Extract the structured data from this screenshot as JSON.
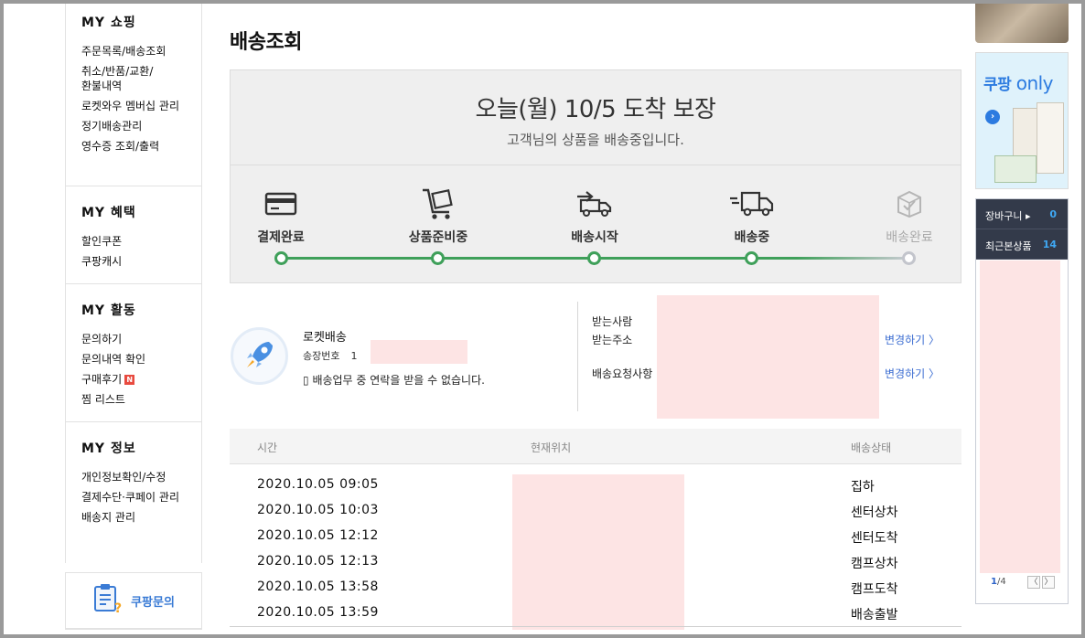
{
  "page": {
    "title": "배송조회"
  },
  "sidebar": {
    "sections": [
      {
        "title": "MY 쇼핑",
        "items": [
          "주문목록/배송조회",
          "취소/반품/교환/환불내역",
          "로켓와우 멤버십 관리",
          "정기배송관리",
          "영수증 조회/출력"
        ]
      },
      {
        "title": "MY 혜택",
        "items": [
          "할인쿠폰",
          "쿠팡캐시"
        ]
      },
      {
        "title": "MY 활동",
        "items": [
          "문의하기",
          "문의내역 확인",
          "구매후기",
          "찜 리스트"
        ],
        "new_badge": "N"
      },
      {
        "title": "MY 정보",
        "items": [
          "개인정보확인/수정",
          "결제수단·쿠페이 관리",
          "배송지 관리"
        ]
      }
    ],
    "cs_label": "쿠팡문의"
  },
  "status": {
    "headline": "오늘(월) 10/5 도착 보장",
    "subline": "고객님의 상품을 배송중입니다.",
    "steps": [
      {
        "label": "결제완료",
        "icon": "credit-card-icon",
        "done": true
      },
      {
        "label": "상품준비중",
        "icon": "cart-box-icon",
        "done": true
      },
      {
        "label": "배송시작",
        "icon": "truck-start-icon",
        "done": true
      },
      {
        "label": "배송중",
        "icon": "truck-moving-icon",
        "done": true
      },
      {
        "label": "배송완료",
        "icon": "box-check-icon",
        "done": false
      }
    ],
    "color_done": "#3fa05a",
    "color_pending": "#c3c5cc"
  },
  "delivery": {
    "type": "로켓배송",
    "invoice_label": "송장번호",
    "invoice_prefix": "1",
    "notice": "배송업무 중 연락을 받을 수 없습니다.",
    "recipient_label": "받는사람",
    "address_label": "받는주소",
    "request_label": "배송요청사항",
    "change_label": "변경하기 〉"
  },
  "tracking": {
    "columns": [
      "시간",
      "현재위치",
      "배송상태"
    ],
    "rows": [
      {
        "time": "2020.10.05 09:05",
        "status": "집하"
      },
      {
        "time": "2020.10.05 10:03",
        "status": "센터상차"
      },
      {
        "time": "2020.10.05 12:12",
        "status": "센터도착"
      },
      {
        "time": "2020.10.05 12:13",
        "status": "캠프상차"
      },
      {
        "time": "2020.10.05 13:58",
        "status": "캠프도착"
      },
      {
        "time": "2020.10.05 13:59",
        "status": "배송출발"
      }
    ]
  },
  "right_panel": {
    "ad_brand": "쿠팡",
    "ad_brand_suffix": "only",
    "cart_label": "장바구니 ▸",
    "cart_count": "0",
    "recent_label": "최근본상품",
    "recent_count": "14",
    "pager_current": "1",
    "pager_total": "/4",
    "prev": "〈",
    "next": "〉"
  }
}
